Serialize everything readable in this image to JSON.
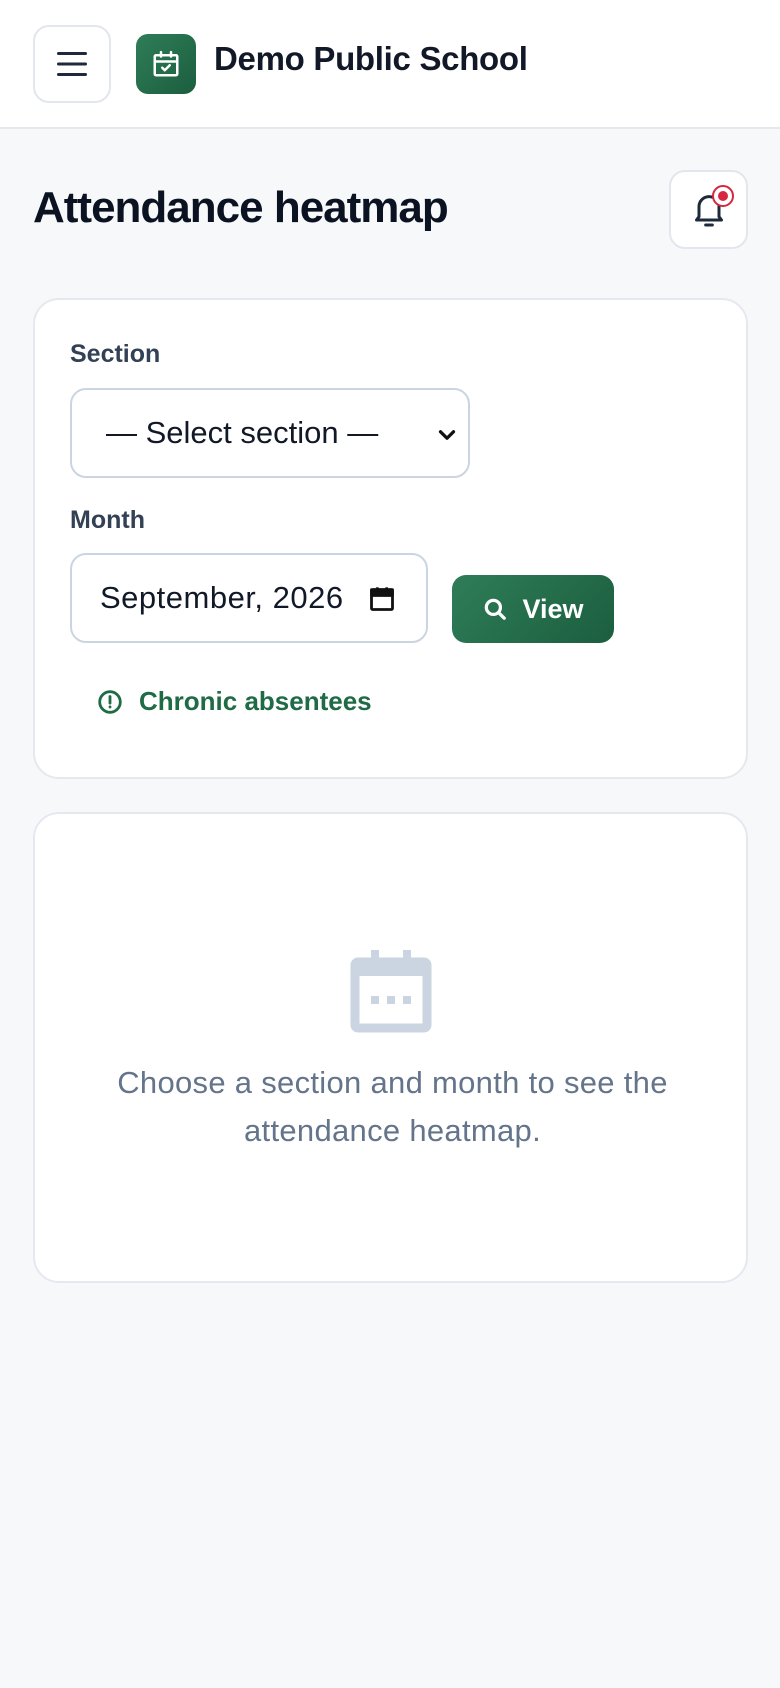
{
  "header": {
    "school_name": "Demo Public School"
  },
  "page": {
    "title": "Attendance heatmap"
  },
  "filters": {
    "section_label": "Section",
    "section_value": "— Select section —",
    "month_label": "Month",
    "month_value": "September, 2026",
    "view_button": "View",
    "chronic_link": "Chronic absentees"
  },
  "empty_state": {
    "message": "Choose a section and month to see the attendance heatmap."
  },
  "colors": {
    "brand": "#1f6b46",
    "notification": "#d7263d",
    "muted": "#64748b"
  },
  "icons": [
    "menu-icon",
    "calendar-check-icon",
    "bell-icon",
    "chevron-down-icon",
    "calendar-icon",
    "search-icon",
    "alert-circle-icon",
    "calendar-empty-icon"
  ]
}
